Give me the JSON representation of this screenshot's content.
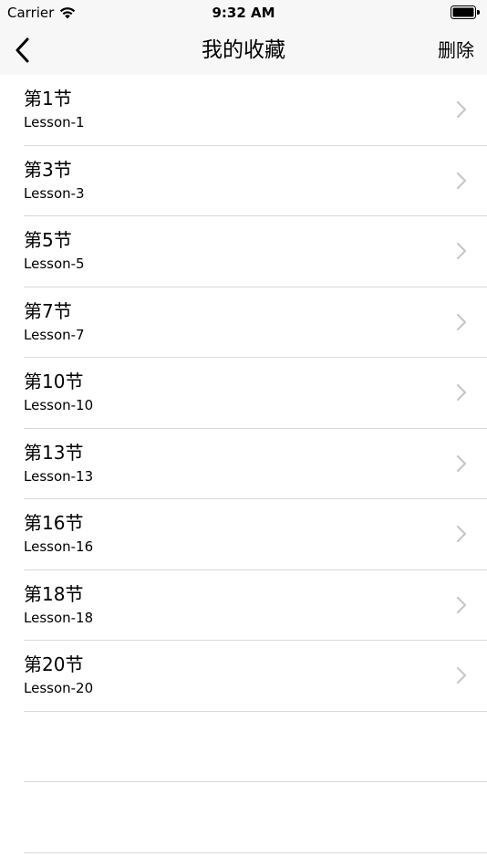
{
  "status_bar": {
    "carrier": "Carrier",
    "time": "9:32 AM"
  },
  "nav": {
    "title": "我的收藏",
    "delete_label": "删除"
  },
  "lessons": [
    {
      "title": "第1节",
      "subtitle": "Lesson-1"
    },
    {
      "title": "第3节",
      "subtitle": "Lesson-3"
    },
    {
      "title": "第5节",
      "subtitle": "Lesson-5"
    },
    {
      "title": "第7节",
      "subtitle": "Lesson-7"
    },
    {
      "title": "第10节",
      "subtitle": "Lesson-10"
    },
    {
      "title": "第13节",
      "subtitle": "Lesson-13"
    },
    {
      "title": "第16节",
      "subtitle": "Lesson-16"
    },
    {
      "title": "第18节",
      "subtitle": "Lesson-18"
    },
    {
      "title": "第20节",
      "subtitle": "Lesson-20"
    }
  ],
  "icons": {
    "back": "chevron-left-icon",
    "row_accessory": "chevron-right-icon",
    "wifi": "wifi-icon",
    "battery": "battery-icon"
  },
  "colors": {
    "bar_background": "#f7f7f7",
    "separator": "#d9d9d9",
    "chevron": "#c7c7cc",
    "text": "#000000"
  }
}
